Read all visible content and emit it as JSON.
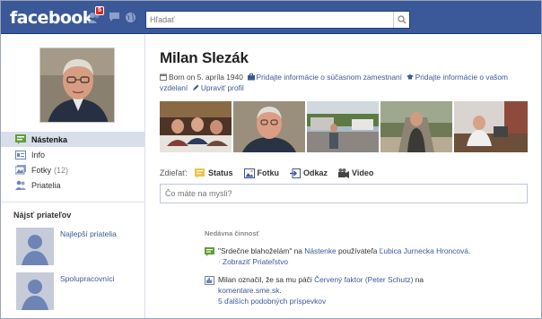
{
  "topbar": {
    "logo": "facebook",
    "notifications_count": "5",
    "search_placeholder": "Hľadať"
  },
  "profile": {
    "name": "Milan Slezák",
    "born": "Born on 5. apríla 1940",
    "add_work": "Pridajte informácie o súčasnom zamestnaní",
    "add_education": "Pridajte informácie o vašom vzdelaní",
    "edit_profile": "Upraviť profil"
  },
  "nav": [
    {
      "label": "Nástenka",
      "icon": "wall-icon"
    },
    {
      "label": "Info",
      "icon": "info-icon"
    },
    {
      "label": "Fotky",
      "count": "(12)",
      "icon": "photos-icon"
    },
    {
      "label": "Priatelia",
      "icon": "friends-icon"
    }
  ],
  "find_friends": {
    "heading": "Nájsť priateľov",
    "items": [
      {
        "label": "Najlepší priatelia"
      },
      {
        "label": "Spolupracovníci"
      }
    ]
  },
  "share": {
    "label": "Zdieľať:",
    "items": [
      {
        "label": "Status",
        "icon": "status-icon"
      },
      {
        "label": "Fotku",
        "icon": "photo-icon"
      },
      {
        "label": "Odkaz",
        "icon": "link-icon"
      },
      {
        "label": "Video",
        "icon": "video-icon"
      }
    ],
    "placeholder": "Čo máte na mysli?"
  },
  "recent": {
    "heading": "Nedávna činnosť",
    "story1": {
      "quote": "\"Srdečne blahoželám\"",
      "on": " na ",
      "wall": "Nástenke",
      "user_text": " používateľa ",
      "user": "Ľubica Jurnecka Hroncová",
      "end": ".",
      "action": "Zobraziť Priateľstvo"
    },
    "story2": {
      "text1": "Milan označil, že sa mu páči ",
      "page": "Červený faktor (Peter Schutz)",
      "text2": " na ",
      "site": "komentare.sme.sk",
      "end": ".",
      "more": "5 ďalších podobných príspevkov"
    }
  },
  "colors": {
    "brand": "#3b5998",
    "nav_active": "#d8dfea",
    "badge": "#d02b2b"
  }
}
